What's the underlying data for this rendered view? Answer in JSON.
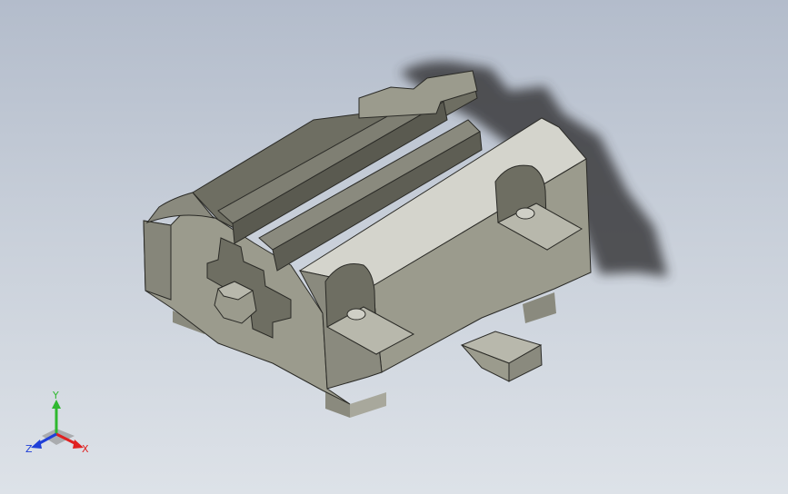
{
  "triad": {
    "x_label": "X",
    "y_label": "Y",
    "z_label": "Z",
    "x_color": "#e02020",
    "y_color": "#2fb82f",
    "z_color": "#1f3fd8"
  },
  "colors": {
    "background_top": "#b3bccb",
    "background_bottom": "#dde2e8",
    "part_light": "#d4d4cc",
    "part_mid": "#9b9b8d",
    "part_dark": "#6e6e62",
    "part_darker": "#5a5a50",
    "shadow": "#3a3a3e"
  }
}
